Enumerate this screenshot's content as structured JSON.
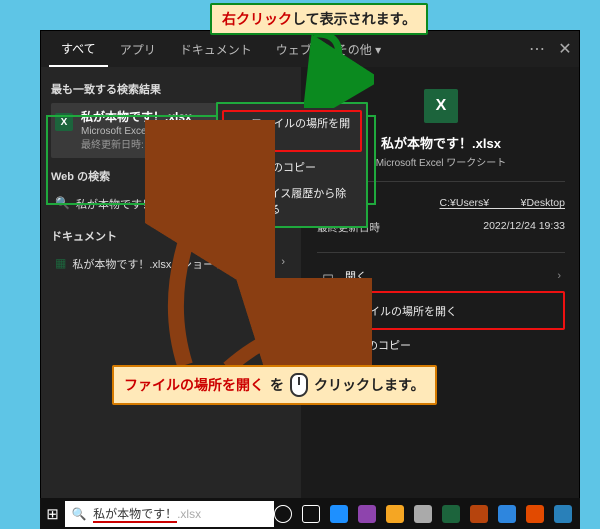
{
  "callouts": {
    "top": {
      "accent": "右クリック",
      "rest": "して表示されます。"
    },
    "bottom": {
      "accent": "ファイルの場所を開く",
      "mid": "を",
      "tail": "クリックします。"
    }
  },
  "tabs": {
    "all": "すべて",
    "apps": "アプリ",
    "docs": "ドキュメント",
    "web": "ウェブ",
    "more": "その他"
  },
  "left": {
    "best_match_header": "最も一致する検索結果",
    "result": {
      "title": "私が本物です！.xlsx",
      "sub": "Microsoft Excel ワークシート",
      "updated": "最終更新日時: 2022/12/24 19:33"
    },
    "web_header": "Web の検索",
    "web_line": "私が本物です！ - Web 結果を開く",
    "doc_header": "ドキュメント",
    "shortcut_line": "私が本物です！.xlsx - ショートカット.lnk"
  },
  "contextMenu": {
    "open_location": "ファイルの場所を開く",
    "copy_path": "パスのコピー",
    "remove_history": "デバイス履歴から除外する"
  },
  "detail": {
    "title": "私が本物です！.xlsx",
    "sub": "Microsoft Excel ワークシート",
    "loc_key": "場所",
    "loc_val": "C:¥Users¥　　　¥Desktop",
    "upd_key": "最終更新日時",
    "upd_val": "2022/12/24 19:33",
    "open": "開く",
    "open_location": "ファイルの場所を開く",
    "copy_path": "パスのコピー"
  },
  "search": {
    "match": "私が本物です！",
    "rest": ".xlsx"
  },
  "icons": {
    "excel_letter": "X"
  },
  "colors": {
    "tray": [
      "#1e90ff",
      "#8e44ad",
      "#f5a623",
      "#aaaaaa",
      "#1c643c",
      "#b6440d",
      "#2e86de",
      "#e24a00",
      "#2980b9"
    ]
  }
}
